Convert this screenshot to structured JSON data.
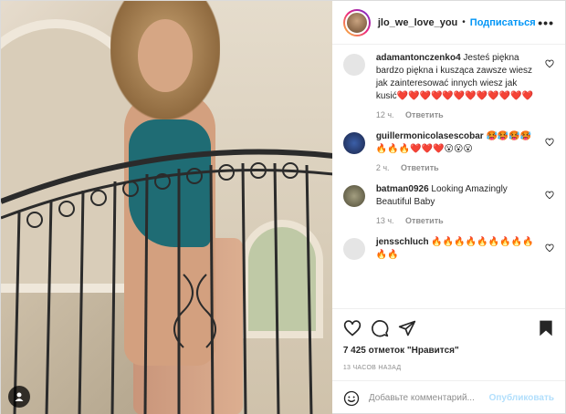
{
  "post": {
    "username": "jlo_we_love_you",
    "separator": "•",
    "follow_label": "Подписаться",
    "more_label": "•••"
  },
  "comments": [
    {
      "user": "adamantonczenko4",
      "text": "Jesteś piękna bardzo piękna i kusząca zawsze wiesz jak zainteresować innych wiesz jak kusić❤️❤️❤️❤️❤️❤️❤️❤️❤️❤️❤️❤️",
      "time": "12 ч.",
      "reply": "Ответить",
      "avatar_color": "#e5e5e5"
    },
    {
      "user": "guillermonicolasescobar",
      "text": "🥵🥵🥵🥵🔥🔥🔥❤️❤️❤️😮😮😮",
      "time": "2 ч.",
      "reply": "Ответить",
      "avatar_color": "#2a3b6b"
    },
    {
      "user": "batman0926",
      "text": "Looking Amazingly Beautiful Baby",
      "time": "13 ч.",
      "reply": "Ответить",
      "avatar_color": "#8a8a6a"
    },
    {
      "user": "jensschluch",
      "text": "🔥🔥🔥🔥🔥🔥🔥🔥🔥🔥🔥",
      "time": "",
      "reply": "",
      "avatar_color": "#e5e5e5"
    }
  ],
  "actions": {
    "likes": "7 425 отметок \"Нравится\"",
    "timestamp": "13 часов назад"
  },
  "add_comment": {
    "placeholder": "Добавьте комментарий...",
    "publish_label": "Опубликовать"
  },
  "icons": [
    "heart-icon",
    "comment-icon",
    "share-icon",
    "bookmark-icon",
    "emoji-icon",
    "user-tag-icon",
    "more-icon"
  ],
  "colors": {
    "accent": "#0095f6",
    "publish_disabled": "#b2dffc",
    "muted": "#8e8e8e",
    "heart": "#ed4956"
  }
}
